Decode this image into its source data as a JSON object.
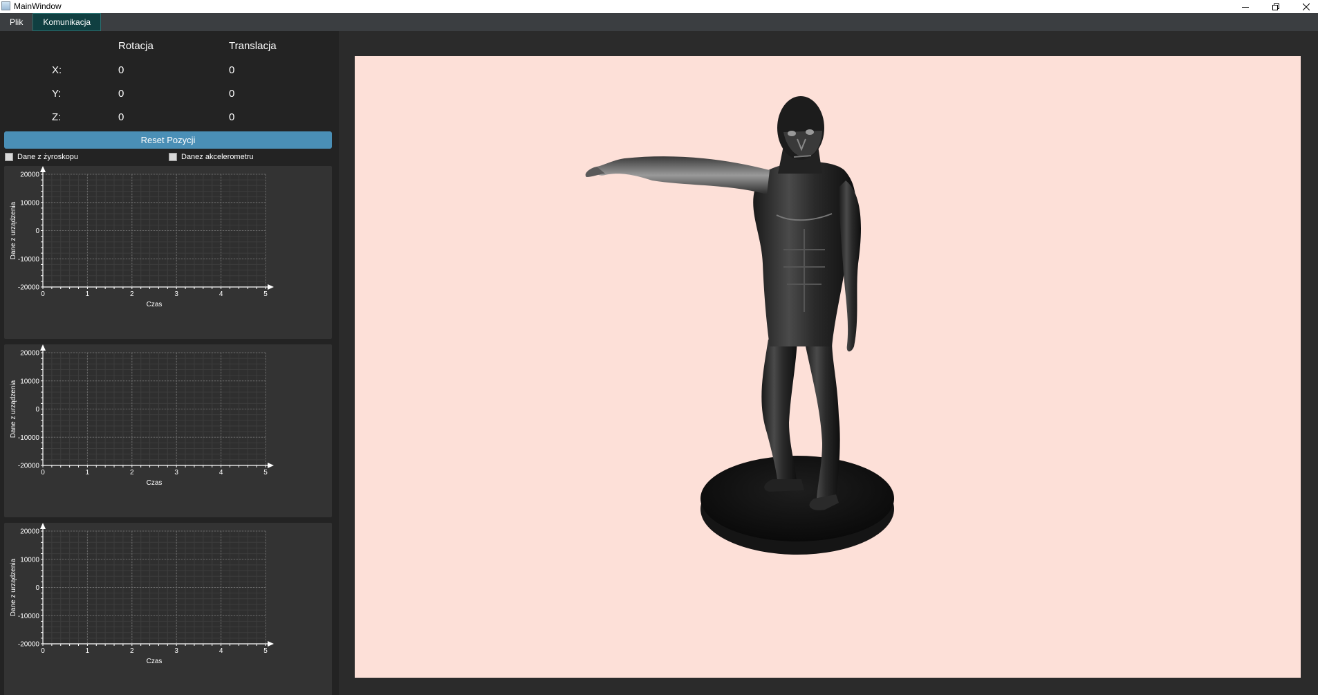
{
  "window": {
    "title": "MainWindow",
    "minimize_icon": "minimize-icon",
    "restore_icon": "restore-icon",
    "close_icon": "close-icon"
  },
  "menu": {
    "items": [
      {
        "label": "Plik",
        "active": false
      },
      {
        "label": "Komunikacja",
        "active": true
      }
    ]
  },
  "position": {
    "headers": {
      "rotation": "Rotacja",
      "translation": "Translacja"
    },
    "rows": [
      {
        "axis": "X:",
        "rotation": "0",
        "translation": "0"
      },
      {
        "axis": "Y:",
        "rotation": "0",
        "translation": "0"
      },
      {
        "axis": "Z:",
        "rotation": "0",
        "translation": "0"
      }
    ],
    "reset_label": "Reset Pozycji"
  },
  "checkboxes": {
    "gyro": {
      "label": "Dane z żyroskopu",
      "checked": false
    },
    "accel": {
      "label": "Danez akcelerometru",
      "checked": false
    }
  },
  "colors": {
    "panel_bg": "#232323",
    "chart_bg": "#333333",
    "accent": "#4a8fb6",
    "viewport_bg": "#fde0d8"
  },
  "chart_data": [
    {
      "type": "line",
      "title": "",
      "xlabel": "Czas",
      "ylabel": "Dane z urządzenia",
      "xlim": [
        0,
        5
      ],
      "ylim": [
        -20000,
        20000
      ],
      "x_ticks": [
        "0",
        "1",
        "2",
        "3",
        "4",
        "5"
      ],
      "y_ticks": [
        "20000",
        "10000",
        "0",
        "-10000",
        "-20000"
      ],
      "grid": true,
      "series": []
    },
    {
      "type": "line",
      "title": "",
      "xlabel": "Czas",
      "ylabel": "Dane z urządzenia",
      "xlim": [
        0,
        5
      ],
      "ylim": [
        -20000,
        20000
      ],
      "x_ticks": [
        "0",
        "1",
        "2",
        "3",
        "4",
        "5"
      ],
      "y_ticks": [
        "20000",
        "10000",
        "0",
        "-10000",
        "-20000"
      ],
      "grid": true,
      "series": []
    },
    {
      "type": "line",
      "title": "",
      "xlabel": "Czas",
      "ylabel": "Dane z urządzenia",
      "xlim": [
        0,
        5
      ],
      "ylim": [
        -20000,
        20000
      ],
      "x_ticks": [
        "0",
        "1",
        "2",
        "3",
        "4",
        "5"
      ],
      "y_ticks": [
        "20000",
        "10000",
        "0",
        "-10000",
        "-20000"
      ],
      "grid": true,
      "series": []
    }
  ],
  "viewport": {
    "model_icon": "human-figure-icon"
  }
}
